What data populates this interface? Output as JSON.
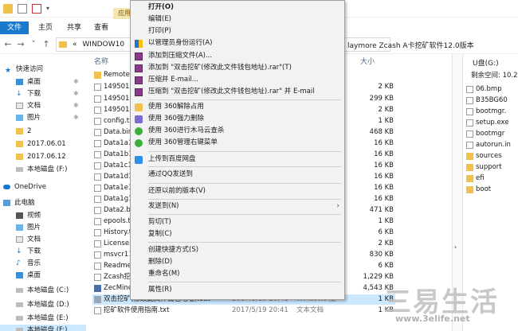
{
  "titlebar": {
    "app_tools_label": "应用"
  },
  "ribbon": {
    "tabs": [
      "文件",
      "主页",
      "共享",
      "查看"
    ]
  },
  "address": {
    "path_prefix": "«",
    "path_folder": "WINDOW10",
    "path_visible_right": "laymore Zcash A卡挖矿软件12.0版本"
  },
  "columns": {
    "name": "名称",
    "size": "大小"
  },
  "nav": {
    "quick_access": "快速访问",
    "items": [
      {
        "label": "桌面",
        "pinned": true
      },
      {
        "label": "下载",
        "pinned": true
      },
      {
        "label": "文档",
        "pinned": true
      },
      {
        "label": "图片",
        "pinned": true
      },
      {
        "label": "2",
        "pinned": false
      },
      {
        "label": "2017.06.01",
        "pinned": false
      },
      {
        "label": "2017.06.12",
        "pinned": false
      },
      {
        "label": "本地磁盘 (F:)",
        "pinned": false
      }
    ],
    "onedrive": "OneDrive",
    "this_pc": "此电脑",
    "pc_items": [
      "视频",
      "图片",
      "文档",
      "下载",
      "音乐",
      "桌面",
      "本地磁盘 (C:)",
      "本地磁盘 (D:)",
      "本地磁盘 (E:)",
      "本地磁盘 (F:)"
    ]
  },
  "files": [
    {
      "name": "Remote",
      "size": "",
      "type": "folder"
    },
    {
      "name": "1495014",
      "size": "2 KB",
      "type": "file"
    },
    {
      "name": "1495014",
      "size": "299 KB",
      "type": "file"
    },
    {
      "name": "1495019",
      "size": "2 KB",
      "type": "file"
    },
    {
      "name": "config.tx",
      "size": "1 KB",
      "type": "file"
    },
    {
      "name": "Data.bin",
      "size": "468 KB",
      "type": "file"
    },
    {
      "name": "Data1a1",
      "size": "16 KB",
      "type": "file"
    },
    {
      "name": "Data1b1",
      "size": "16 KB",
      "type": "file"
    },
    {
      "name": "Data1c1",
      "size": "16 KB",
      "type": "file"
    },
    {
      "name": "Data1d1",
      "size": "16 KB",
      "type": "file"
    },
    {
      "name": "Data1e1",
      "size": "16 KB",
      "type": "file"
    },
    {
      "name": "Data1g1",
      "size": "16 KB",
      "type": "file"
    },
    {
      "name": "Data2.b",
      "size": "471 KB",
      "type": "file"
    },
    {
      "name": "epools.t",
      "size": "1 KB",
      "type": "file"
    },
    {
      "name": "History.t",
      "size": "6 KB",
      "type": "file"
    },
    {
      "name": "License.",
      "size": "2 KB",
      "type": "file"
    },
    {
      "name": "msvcr11",
      "size": "830 KB",
      "type": "file"
    },
    {
      "name": "Readme",
      "size": "6 KB",
      "type": "file"
    },
    {
      "name": "Zcash挖",
      "size": "1,229 KB",
      "type": "file"
    },
    {
      "name": "ZecMine",
      "size": "4,543 KB",
      "type": "app"
    },
    {
      "name": "双击挖矿(修改此文件钱包地址).bat",
      "size": "1 KB",
      "type": "bat",
      "date": "2017/5/19 20:41",
      "ftype": "Windows 批处理..."
    },
    {
      "name": "挖矿软件使用指南.txt",
      "size": "1 KB",
      "type": "txt",
      "date": "2017/5/19 20:41",
      "ftype": "文本文档"
    }
  ],
  "rightpane": {
    "drive": "U盘(G:)",
    "free": "剩余空间: 10.2",
    "items": [
      "06.bmp",
      "B35BG60",
      "bootmgr.",
      "setup.exe",
      "bootmgr",
      "autorun.in",
      "sources",
      "support",
      "efi",
      "boot"
    ]
  },
  "context_menu": {
    "items": [
      {
        "label": "打开(O)",
        "bold": true
      },
      {
        "label": "编辑(E)"
      },
      {
        "label": "打印(P)"
      },
      {
        "label": "以管理员身份运行(A)",
        "icon": "shield-icon"
      },
      {
        "label": "添加到压缩文件(A)...",
        "icon": "winrar-icon"
      },
      {
        "label": "添加到 \"双击挖矿(修改此文件钱包地址).rar\"(T)",
        "icon": "winrar-icon"
      },
      {
        "label": "压缩并 E-mail...",
        "icon": "winrar-icon"
      },
      {
        "label": "压缩到 \"双击挖矿(修改此文件钱包地址).rar\" 并 E-mail",
        "icon": "winrar-icon"
      },
      {
        "label": "使用 360解除占用",
        "icon": "360-unlock-icon"
      },
      {
        "label": "使用 360强力删除",
        "icon": "360-delete-icon"
      },
      {
        "label": "使用 360进行木马云查杀",
        "icon": "360-scan-icon"
      },
      {
        "label": "使用 360管理右键菜单",
        "icon": "360-menu-icon"
      },
      {
        "label": "上传到百度网盘",
        "icon": "baidu-cloud-icon"
      },
      {
        "label": "通过QQ发送到"
      },
      {
        "label": "还原以前的版本(V)"
      },
      {
        "label": "发送到(N)",
        "submenu": true
      },
      {
        "label": "剪切(T)"
      },
      {
        "label": "复制(C)"
      },
      {
        "label": "创建快捷方式(S)"
      },
      {
        "label": "删除(D)"
      },
      {
        "label": "重命名(M)"
      },
      {
        "label": "属性(R)"
      }
    ]
  },
  "watermark": {
    "text": "三易生活",
    "url": "www.3elife.net"
  },
  "colors": {
    "accent": "#1979ca",
    "folder": "#f0c24b",
    "selection": "#cce8ff"
  }
}
